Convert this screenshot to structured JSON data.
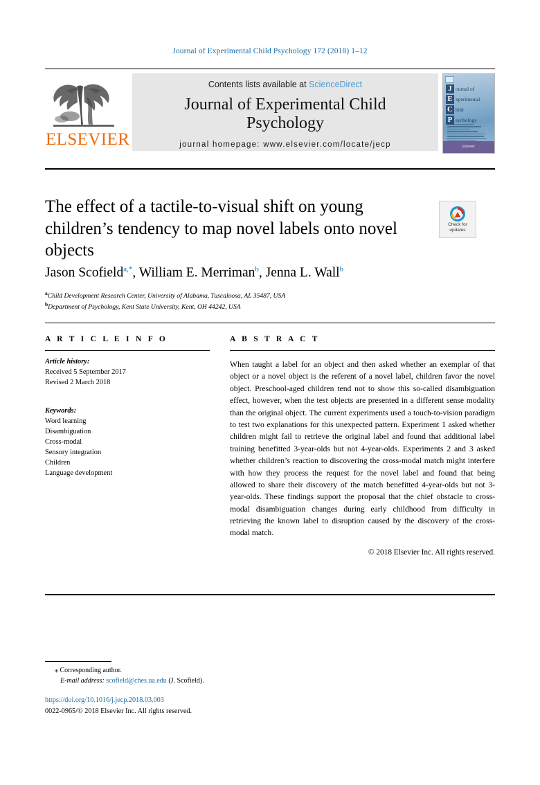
{
  "running_head": "Journal of Experimental Child Psychology 172 (2018) 1–12",
  "masthead": {
    "contents_prefix": "Contents lists available at ",
    "sciencedirect": "ScienceDirect",
    "journal_name_line1": "Journal of Experimental Child",
    "journal_name_line2": "Psychology",
    "homepage": "journal homepage: www.elsevier.com/locate/jecp",
    "publisher_wordmark": "ELSEVIER",
    "publisher_logo_icon": "elsevier-tree-icon",
    "cover": {
      "letters": [
        "J",
        "E",
        "C",
        "P"
      ],
      "words": [
        "ournal of",
        "xperimental",
        "hild",
        "sychology"
      ],
      "footer_text": "Elsevier"
    },
    "colors": {
      "link_blue": "#4a9ad4",
      "elsevier_orange": "#eb6a0a",
      "mast_bg": "#e6e6e6"
    }
  },
  "article": {
    "title": "The effect of a tactile-to-visual shift on young children’s tendency to map novel labels onto novel objects",
    "crossmark_line1": "Check for",
    "crossmark_line2": "updates",
    "crossmark_icon": "crossmark-badge-icon",
    "authors": [
      {
        "name": "Jason Scofield",
        "marks": "a,*"
      },
      {
        "name": "William E. Merriman",
        "marks": "b"
      },
      {
        "name": "Jenna L. Wall",
        "marks": "b"
      }
    ],
    "affiliations": [
      {
        "mark": "a",
        "text": "Child Development Research Center, University of Alabama, Tuscaloosa, AL 35487, USA"
      },
      {
        "mark": "b",
        "text": "Department of Psychology, Kent State University, Kent, OH 44242, USA"
      }
    ]
  },
  "article_info": {
    "heading": "A R T I C L E  I N F O",
    "history_label": "Article history:",
    "history": [
      "Received 5 September 2017",
      "Revised 2 March 2018"
    ],
    "keywords_label": "Keywords:",
    "keywords": [
      "Word learning",
      "Disambiguation",
      "Cross-modal",
      "Sensory integration",
      "Children",
      "Language development"
    ]
  },
  "abstract": {
    "heading": "A B S T R A C T",
    "text": "When taught a label for an object and then asked whether an exemplar of that object or a novel object is the referent of a novel label, children favor the novel object. Preschool-aged children tend not to show this so-called disambiguation effect, however, when the test objects are presented in a different sense modality than the original object. The current experiments used a touch-to-vision paradigm to test two explanations for this unexpected pattern. Experiment 1 asked whether children might fail to retrieve the original label and found that additional label training benefitted 3-year-olds but not 4-year-olds. Experiments 2 and 3 asked whether children’s reaction to discovering the cross-modal match might interfere with how they process the request for the novel label and found that being allowed to share their discovery of the match benefitted 4-year-olds but not 3-year-olds. These findings support the proposal that the chief obstacle to cross-modal disambiguation changes during early childhood from difficulty in retrieving the known label to disruption caused by the discovery of the cross-modal match.",
    "copyright": "© 2018 Elsevier Inc. All rights reserved."
  },
  "footer": {
    "corresponding_marker": "⁎",
    "corresponding_text": "Corresponding author.",
    "email_label": "E-mail address:",
    "email": "scofield@ches.ua.edu",
    "email_owner": "(J. Scofield).",
    "doi": "https://doi.org/10.1016/j.jecp.2018.03.003",
    "issn_line": "0022-0965/© 2018 Elsevier Inc. All rights reserved."
  }
}
